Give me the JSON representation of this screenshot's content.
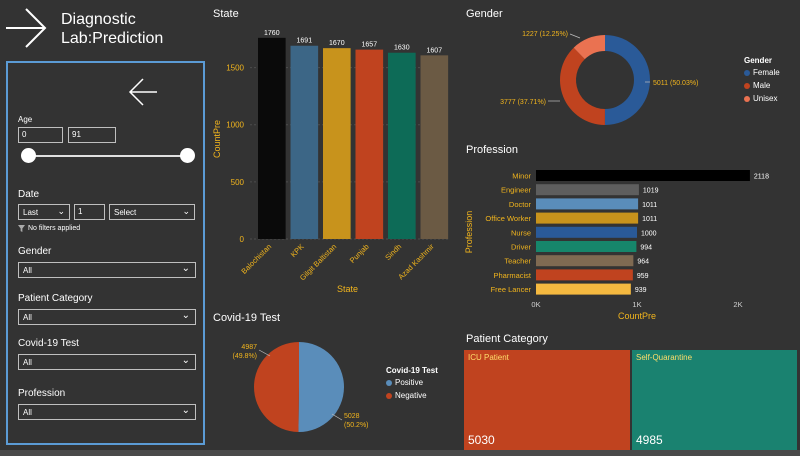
{
  "header": {
    "title": "Diagnostic Lab:Prediction"
  },
  "filters": {
    "age_label": "Age",
    "age_min": "0",
    "age_max": "91",
    "age_min_value": 0,
    "age_max_value": 91,
    "date_label": "Date",
    "date_mode": "Last",
    "date_count": "1",
    "date_unit": "Select",
    "no_filters": "No filters applied",
    "gender_label": "Gender",
    "gender_value": "All",
    "patient_category_label": "Patient Category",
    "patient_category_value": "All",
    "covid_label": "Covid-19 Test",
    "covid_value": "All",
    "profession_label": "Profession",
    "profession_value": "All"
  },
  "state_chart": {
    "title": "State"
  },
  "gender_chart": {
    "title": "Gender"
  },
  "profession_chart": {
    "title": "Profession"
  },
  "covid_chart": {
    "title": "Covid-19 Test"
  },
  "patient_category": {
    "title": "Patient Category",
    "tiles": [
      {
        "name": "ICU Patient",
        "value": "5030",
        "color": "#c0431f"
      },
      {
        "name": "Self-Quarantine",
        "value": "4985",
        "color": "#1a8270"
      }
    ]
  },
  "colors": {
    "accent_text": "#f2b51d",
    "panel_border": "#5b9bd5",
    "female": "#2a5a98",
    "male": "#c0431f",
    "unisex": "#ea7251",
    "positive": "#5a8dba",
    "negative": "#c0431f"
  },
  "icons": [
    "arrow-right-icon",
    "arrow-left-icon",
    "chevron-down-icon",
    "filter-icon"
  ],
  "chart_data": [
    {
      "type": "bar",
      "title": "State",
      "xlabel": "State",
      "ylabel": "CountPre",
      "categories": [
        "Balochistan",
        "KPK",
        "Gilgit Baltistan",
        "Punjab",
        "Sindh",
        "Azad Kashmir"
      ],
      "values": [
        1760,
        1691,
        1670,
        1657,
        1630,
        1607
      ],
      "colors": [
        "#0a0a0a",
        "#3c6686",
        "#c8931c",
        "#c0431f",
        "#0d6b57",
        "#6b5a44"
      ],
      "ylim": [
        0,
        1750
      ],
      "yticks": [
        "0",
        "500",
        "1000",
        "1500"
      ],
      "grid": true
    },
    {
      "type": "pie",
      "title": "Gender",
      "legend_title": "Gender",
      "categories": [
        "Female",
        "Male",
        "Unisex"
      ],
      "values": [
        5011,
        3777,
        1227
      ],
      "labels": [
        "5011 (50.03%)",
        "3777 (37.71%)",
        "1227 (12.25%)"
      ],
      "colors": [
        "#2a5a98",
        "#c0431f",
        "#ea7251"
      ],
      "legend_position": "right"
    },
    {
      "type": "bar",
      "orientation": "horizontal",
      "title": "Profession",
      "xlabel": "CountPre",
      "ylabel": "Profession",
      "categories": [
        "Minor",
        "Engineer",
        "Doctor",
        "Office Worker",
        "Nurse",
        "Driver",
        "Teacher",
        "Pharmacist",
        "Free Lancer"
      ],
      "values": [
        2118,
        1019,
        1011,
        1011,
        1000,
        994,
        964,
        959,
        939
      ],
      "colors": [
        "#000000",
        "#5e5e5e",
        "#5a8dba",
        "#c8931c",
        "#2a5a98",
        "#16866b",
        "#7f6a52",
        "#c0431f",
        "#f5b940"
      ],
      "xlim": [
        0,
        2000
      ],
      "xticks": [
        "0K",
        "1K",
        "2K"
      ]
    },
    {
      "type": "pie",
      "title": "Covid-19 Test",
      "legend_title": "Covid-19 Test",
      "categories": [
        "Positive",
        "Negative"
      ],
      "values": [
        5028,
        4987
      ],
      "labels": [
        "5028\n(50.2%)",
        "4987\n(49.8%)"
      ],
      "colors": [
        "#5a8dba",
        "#c0431f"
      ],
      "legend_position": "right"
    }
  ]
}
